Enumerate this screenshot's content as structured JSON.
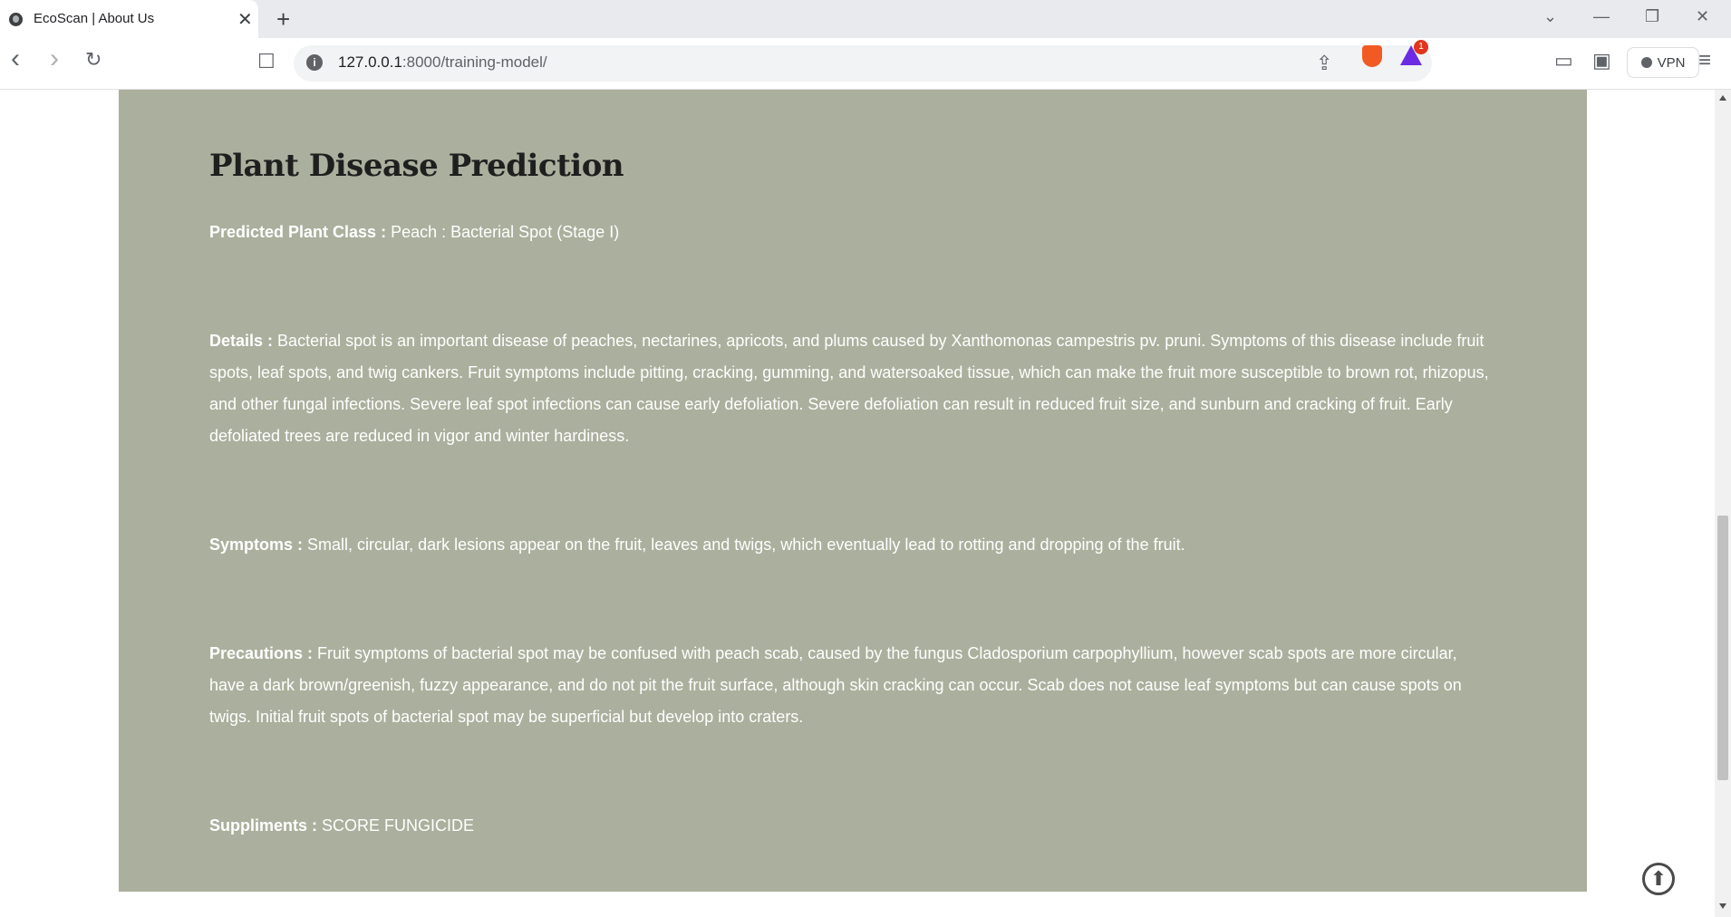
{
  "browser": {
    "tab_title": "EcoScan | About Us",
    "tab_close": "✕",
    "new_tab": "+",
    "url_host": "127.0.0.1",
    "url_rest": ":8000/training-model/",
    "vpn_label": "VPN",
    "bat_badge": "1",
    "icons": {
      "back": "‹",
      "forward": "›",
      "reload": "↻",
      "bookmark": "☐",
      "share": "⇪",
      "sidebar": "▭",
      "wallet": "▣",
      "menu": "≡",
      "minimize": "—",
      "restore": "❐",
      "close": "✕",
      "dropdown": "⌄"
    }
  },
  "page": {
    "title": "Plant Disease Prediction",
    "predicted_label": "Predicted Plant Class :",
    "predicted_value": "Peach : Bacterial Spot (Stage I)",
    "details_label": "Details :",
    "details_value": "Bacterial spot is an important disease of peaches, nectarines, apricots, and plums caused by Xanthomonas campestris pv. pruni. Symptoms of this disease include fruit spots, leaf spots, and twig cankers. Fruit symptoms include pitting, cracking, gumming, and watersoaked tissue, which can make the fruit more susceptible to brown rot, rhizopus, and other fungal infections. Severe leaf spot infections can cause early defoliation. Severe defoliation can result in reduced fruit size, and sunburn and cracking of fruit. Early defoliated trees are reduced in vigor and winter hardiness.",
    "symptoms_label": "Symptoms :",
    "symptoms_value": "Small, circular, dark lesions appear on the fruit, leaves and twigs, which eventually lead to rotting and dropping of the fruit.",
    "precautions_label": "Precautions :",
    "precautions_value": "Fruit symptoms of bacterial spot may be confused with peach scab, caused by the fungus Cladosporium carpophyllium, however scab spots are more circular, have a dark brown/greenish, fuzzy appearance, and do not pit the fruit surface, although skin cracking can occur. Scab does not cause leaf symptoms but can cause spots on twigs. Initial fruit spots of bacterial spot may be superficial but develop into craters.",
    "suppliments_label": "Suppliments :",
    "suppliments_value": "SCORE FUNGICIDE",
    "to_top_icon": "⬆"
  },
  "colors": {
    "card_bg": "#abaf9d",
    "title_color": "#1f1f1f",
    "text_color": "#ffffff"
  }
}
